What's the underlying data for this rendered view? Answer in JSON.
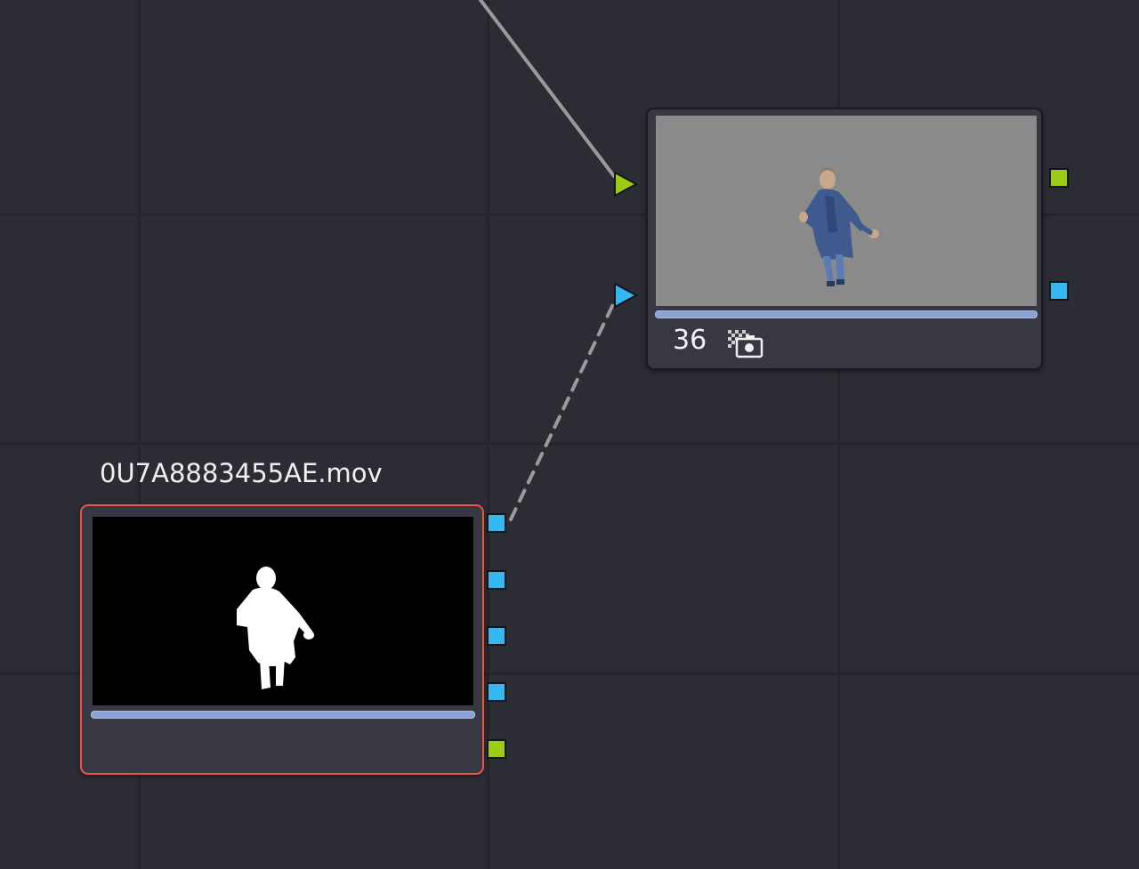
{
  "flow": {
    "nodes": {
      "merge": {
        "number_label": "36",
        "cache_icon": "cache-snapshot-icon",
        "progress": 1.0,
        "inputs": [
          {
            "name": "foreground-input",
            "color": "#9ccc14"
          },
          {
            "name": "mask-input",
            "color": "#35b8f0"
          }
        ],
        "outputs": [
          {
            "name": "image-output",
            "color": "#9ccc14"
          },
          {
            "name": "mask-output",
            "color": "#35b8f0"
          }
        ]
      },
      "media": {
        "title": "0U7A8883455AE.mov",
        "selected": true,
        "progress": 1.0,
        "outputs": [
          {
            "name": "mask-output-1",
            "color": "#35b8f0"
          },
          {
            "name": "mask-output-2",
            "color": "#35b8f0"
          },
          {
            "name": "mask-output-3",
            "color": "#35b8f0"
          },
          {
            "name": "mask-output-4",
            "color": "#35b8f0"
          },
          {
            "name": "image-output",
            "color": "#9ccc14"
          }
        ]
      }
    },
    "colors": {
      "background": "#2c2c34",
      "grid": "#24242a",
      "selection": "#e8574a",
      "node": "#383842",
      "progress": "#8aa3d4",
      "image_port": "#9ccc14",
      "mask_port": "#35b8f0",
      "link": "#9a9a9a"
    }
  }
}
